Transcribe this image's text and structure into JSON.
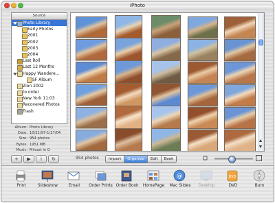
{
  "window": {
    "title": "iPhoto"
  },
  "source": {
    "header": "Source",
    "items": [
      {
        "label": "Photo Library",
        "icon": "photo-library-icon",
        "selected": true,
        "indent": 0,
        "disclosure": true
      },
      {
        "label": "Early Photos",
        "icon": "folder-icon",
        "indent": 1
      },
      {
        "label": "2001",
        "icon": "folder-icon",
        "indent": 1
      },
      {
        "label": "2002",
        "icon": "folder-icon",
        "indent": 1
      },
      {
        "label": "2003",
        "icon": "folder-icon",
        "indent": 1
      },
      {
        "label": "2004",
        "icon": "folder-icon",
        "indent": 1
      },
      {
        "label": "Last Roll",
        "icon": "roll-icon",
        "indent": 0
      },
      {
        "label": "Last 12 Months",
        "icon": "calendar-icon",
        "indent": 0
      },
      {
        "label": "Happy Wandere...",
        "icon": "album-icon",
        "indent": 0,
        "disclosure": true
      },
      {
        "label": "SF Album",
        "icon": "album-icon",
        "indent": 2
      },
      {
        "label": "Zion 2002",
        "icon": "album-icon",
        "indent": 0
      },
      {
        "label": "to order",
        "icon": "album-icon",
        "indent": 0
      },
      {
        "label": "New York 11:03",
        "icon": "album-icon",
        "indent": 0
      },
      {
        "label": "Recovered Photos",
        "icon": "album-icon",
        "indent": 0
      },
      {
        "label": "Trash",
        "icon": "trash-icon",
        "indent": 0
      }
    ]
  },
  "info": [
    {
      "key": "Album:",
      "value": "Photo Library"
    },
    {
      "key": "Date:",
      "value": "10/21/97-1/27/04"
    },
    {
      "key": "Size:",
      "value": "954 photos"
    },
    {
      "key": "Bytes:",
      "value": "1951 MB"
    },
    {
      "key": "Music:",
      "value": "Minuet in G"
    }
  ],
  "source_buttons": [
    {
      "name": "add-album-button",
      "glyph": "+"
    },
    {
      "name": "play-slideshow-button",
      "glyph": "▶"
    },
    {
      "name": "info-button",
      "glyph": "i"
    },
    {
      "name": "rotate-button",
      "glyph": "↻"
    }
  ],
  "status": {
    "photo_count": "954 photos"
  },
  "modes": [
    {
      "label": "Import",
      "active": false
    },
    {
      "label": "Organize",
      "active": true
    },
    {
      "label": "Edit",
      "active": false
    },
    {
      "label": "Book",
      "active": false
    }
  ],
  "zoom": {
    "level": 0.45
  },
  "photos": [
    {
      "top": "#5f93d8",
      "bottom": "#b06a3a",
      "accent": "#dcc2a0"
    },
    {
      "top": "#8fb7e6",
      "bottom": "#a45a2c",
      "accent": "#e8d4b6"
    },
    {
      "top": "#6d8d6a",
      "bottom": "#8a5f3a",
      "accent": "#c9a27a"
    },
    {
      "top": "#7fa8de",
      "bottom": "#6e6f4b",
      "accent": "#d4b58e"
    },
    {
      "top": "#9e5f39",
      "bottom": "#c58654",
      "accent": "#f0d7b9"
    },
    {
      "top": "#6f9ce0",
      "bottom": "#b0693c",
      "accent": "#e0c39c"
    },
    {
      "top": "#7aa3dc",
      "bottom": "#9d5530",
      "accent": "#e9cfa9"
    },
    {
      "top": "#8eaee0",
      "bottom": "#84694a",
      "accent": "#d9c6a4"
    },
    {
      "top": "#8cb3e3",
      "bottom": "#9a8260",
      "accent": "#cfc0a0"
    },
    {
      "top": "#6a93d2",
      "bottom": "#a66a40",
      "accent": "#e1c8a6"
    },
    {
      "top": "#5d8bd4",
      "bottom": "#c07c47",
      "accent": "#f1d9b8"
    },
    {
      "top": "#6e99d9",
      "bottom": "#8e4f2c",
      "accent": "#d7b48c"
    },
    {
      "top": "#a6c3ea",
      "bottom": "#6f5b43",
      "accent": "#cbb99a"
    },
    {
      "top": "#9c5a33",
      "bottom": "#c58454",
      "accent": "#eacca6"
    },
    {
      "top": "#6c96d8",
      "bottom": "#b8764a",
      "accent": "#edd4b3"
    },
    {
      "top": "#71a0e0",
      "bottom": "#9d5f38",
      "accent": "#e5c9a4"
    },
    {
      "top": "#a45c30",
      "bottom": "#d09763",
      "accent": "#f2dcc0"
    },
    {
      "top": "#8f5432",
      "bottom": "#5c8ad1",
      "accent": "#e2c4a0"
    },
    {
      "top": "#6c98da",
      "bottom": "#a6653b",
      "accent": "#ddbf99"
    },
    {
      "top": "#7fa6dd",
      "bottom": "#c27b49",
      "accent": "#f3dbbd"
    },
    {
      "top": "#8db1e3",
      "bottom": "#9b6f49",
      "accent": "#d8c0a0"
    },
    {
      "top": "#b06b3f",
      "bottom": "#e3b184",
      "accent": "#f7e4cc"
    },
    {
      "top": "#a7c5ec",
      "bottom": "#b57b4c",
      "accent": "#eed6b6"
    },
    {
      "top": "#934f2b",
      "bottom": "#c98a57",
      "accent": "#efd3ae"
    },
    {
      "top": "#6a94d6",
      "bottom": "#b77248",
      "accent": "#e7cda9"
    },
    {
      "top": "#86acdf",
      "bottom": "#a36a40",
      "accent": "#e0c6a3"
    },
    {
      "top": "#8a4d2b",
      "bottom": "#b57a4f",
      "accent": "#dcc0a0"
    },
    {
      "top": "#90b6e6",
      "bottom": "#6c7d56",
      "accent": "#cbb893"
    },
    {
      "top": "#9a5a35",
      "bottom": "#d8a77a",
      "accent": "#f5e1c7"
    },
    {
      "top": "#ad6a40",
      "bottom": "#e0b28a",
      "accent": "#f3e0c6"
    },
    {
      "top": "#7aa4e0",
      "bottom": "#8a5332",
      "accent": "#d3b08c"
    },
    {
      "top": "#8bb0e4",
      "bottom": "#977357",
      "accent": "#d6c2a6"
    },
    {
      "top": "#a05f39",
      "bottom": "#c98e60",
      "accent": "#efd5b5"
    },
    {
      "top": "#6e9ad9",
      "bottom": "#b16d41",
      "accent": "#e6cba6"
    },
    {
      "top": "#9bbde9",
      "bottom": "#b98a5c",
      "accent": "#ecd7b9"
    }
  ],
  "toolbar": [
    {
      "label": "Print",
      "icon": "printer-icon"
    },
    {
      "label": "Slideshow",
      "icon": "slideshow-icon"
    },
    {
      "label": "Email",
      "icon": "email-icon"
    },
    {
      "label": "Order Prints",
      "icon": "order-prints-icon"
    },
    {
      "label": "Order Book",
      "icon": "order-book-icon"
    },
    {
      "label": "HomePage",
      "icon": "homepage-icon"
    },
    {
      "label": "Mac Slides",
      "icon": "mac-slides-icon"
    },
    {
      "label": "Desktop",
      "icon": "desktop-icon",
      "disabled": true
    },
    {
      "label": "DVD",
      "icon": "dvd-icon"
    },
    {
      "label": "Burn",
      "icon": "burn-icon"
    }
  ],
  "colors": {
    "selection": "#3875d7",
    "close": "#e0443b",
    "minimize": "#e8b135",
    "zoom": "#54b948"
  }
}
